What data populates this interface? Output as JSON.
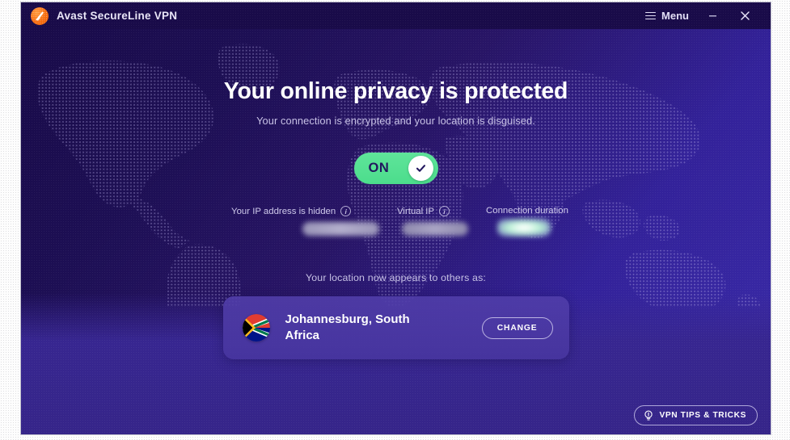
{
  "window": {
    "title": "Avast SecureLine VPN",
    "logo_icon": "avast-logo-icon",
    "menu_label": "Menu",
    "menu_icon": "hamburger-icon",
    "minimize_icon": "minimize-icon",
    "close_icon": "close-icon"
  },
  "main": {
    "headline": "Your online privacy is protected",
    "subheadline": "Your connection is encrypted and your location is disguised.",
    "toggle": {
      "state_label": "ON",
      "checked": true,
      "check_icon": "check-icon",
      "track_color": "#4CDD8C",
      "label_color": "#22175E"
    },
    "stats": [
      {
        "label": "Your IP address is hidden",
        "info_icon": "info-icon",
        "value": "",
        "value_hidden": true
      },
      {
        "label": "Virtual IP",
        "info_icon": "info-icon",
        "value": "",
        "value_hidden": true
      },
      {
        "label": "Connection duration",
        "info_icon": null,
        "value": "",
        "value_hidden": true
      }
    ],
    "location": {
      "prompt": "Your location now appears to others as:",
      "flag_icon": "south-africa-flag-icon",
      "name": "Johannesburg, South Africa",
      "change_label": "CHANGE"
    },
    "tips": {
      "label": "VPN TIPS & TRICKS",
      "icon": "lightbulb-icon"
    }
  },
  "theme": {
    "bg_dark": "#190B49",
    "bg_purple": "#372690",
    "accent_green": "#4CDD8C",
    "accent_orange": "#F76A0C",
    "card_purple": "#513EAA",
    "text_primary": "#FFFFFF",
    "text_muted": "#C8C2E6"
  }
}
